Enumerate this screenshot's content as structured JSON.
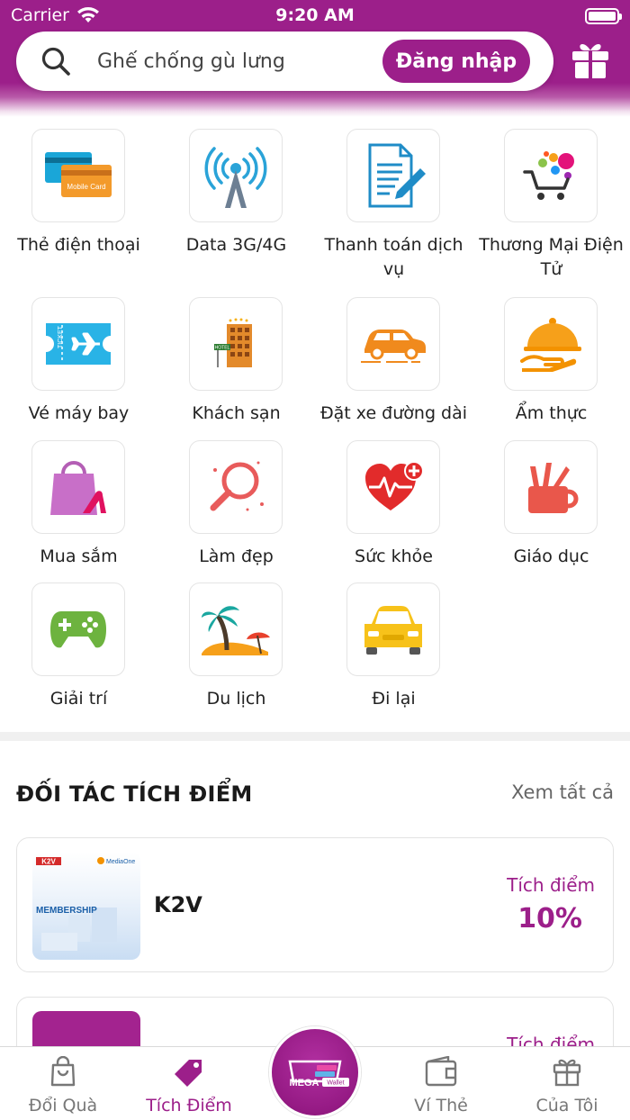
{
  "status_bar": {
    "carrier": "Carrier",
    "time": "9:20 AM"
  },
  "header": {
    "search_placeholder": "Ghế chống gù lưng",
    "login_label": "Đăng nhập"
  },
  "services": [
    {
      "label": "Thẻ điện thoại",
      "icon": "phone-card-icon",
      "icon_text": "Mobile Card"
    },
    {
      "label": "Data 3G/4G",
      "icon": "antenna-icon"
    },
    {
      "label": "Thanh toán dịch vụ",
      "icon": "document-pen-icon"
    },
    {
      "label": "Thương Mại Điện Tử",
      "icon": "shopping-cart-icon"
    },
    {
      "label": "Vé máy bay",
      "icon": "plane-ticket-icon",
      "icon_text": "TICKET"
    },
    {
      "label": "Khách sạn",
      "icon": "hotel-icon",
      "icon_text": "HOTEL"
    },
    {
      "label": "Đặt xe đường dài",
      "icon": "car-icon"
    },
    {
      "label": "Ẩm thực",
      "icon": "food-cloche-icon"
    },
    {
      "label": "Mua sắm",
      "icon": "shopping-bag-icon"
    },
    {
      "label": "Làm đẹp",
      "icon": "mirror-icon"
    },
    {
      "label": "Sức khỏe",
      "icon": "heart-health-icon"
    },
    {
      "label": "Giáo dục",
      "icon": "pencil-cup-icon"
    },
    {
      "label": "Giải trí",
      "icon": "gamepad-icon"
    },
    {
      "label": "Du lịch",
      "icon": "beach-icon"
    },
    {
      "label": "Đi lại",
      "icon": "taxi-icon"
    }
  ],
  "partners": {
    "title": "ĐỐI TÁC TÍCH ĐIỂM",
    "see_all": "Xem tất cả",
    "items": [
      {
        "name": "K2V",
        "points_label": "Tích điểm",
        "points_value": "10%",
        "logo_brand": "K2V",
        "logo_brand2": "MediaOne",
        "logo_text": "MEMBERSHIP"
      },
      {
        "name": "",
        "points_label": "Tích điểm",
        "points_value": ""
      }
    ]
  },
  "bottom_nav": {
    "items": [
      {
        "label": "Đổi Quà",
        "icon": "shopping-bag-outline-icon"
      },
      {
        "label": "Tích Điểm",
        "icon": "price-tag-icon",
        "active": true
      },
      {
        "label": "Ví Thẻ",
        "icon": "wallet-icon"
      },
      {
        "label": "Của Tôi",
        "icon": "gift-outline-icon"
      }
    ],
    "center_brand": "MEGA",
    "center_brand_sub": "Wallet"
  },
  "colors": {
    "brand": "#9c1f8a",
    "text": "#222222",
    "muted": "#777777"
  }
}
